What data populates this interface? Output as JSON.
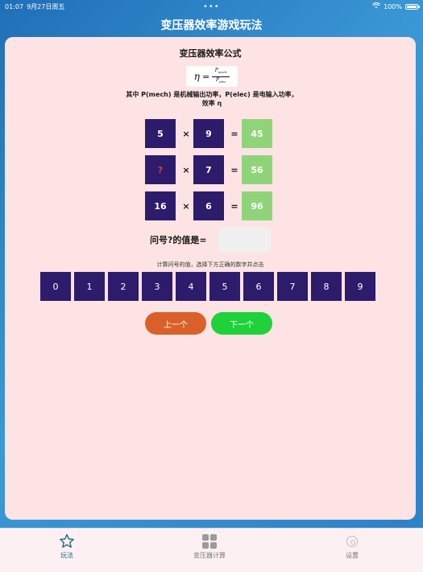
{
  "status_bar": {
    "time": "01:07",
    "date": "9月27日周五",
    "dots": "•••",
    "battery": "100%",
    "battery_level": 1.0
  },
  "header": {
    "title": "变压器效率游戏玩法"
  },
  "card": {
    "title": "变压器效率公式",
    "formula": {
      "eta": "η",
      "equals": "=",
      "numerator": "P",
      "numerator_sub": "mech",
      "denominator": "P",
      "denominator_sub": "elec"
    },
    "description": "其中 P(mech) 是机械输出功率，P(elec) 是电输入功率，效率 η",
    "puzzles": [
      {
        "a": "5",
        "op": "×",
        "b": "9",
        "eq": "=",
        "result": "45"
      },
      {
        "a": "?",
        "op": "×",
        "b": "7",
        "eq": "=",
        "result": "56"
      },
      {
        "a": "16",
        "op": "×",
        "b": "6",
        "eq": "=",
        "result": "96"
      }
    ],
    "answer_label": "问号?的值是=",
    "instruction": "计算问号的值，选择下方正确的数字并点击",
    "digits": [
      "0",
      "1",
      "2",
      "3",
      "4",
      "5",
      "6",
      "7",
      "8",
      "9"
    ],
    "prev_label": "上一个",
    "next_label": "下一个"
  },
  "tabbar": {
    "items": [
      {
        "label": "玩法",
        "icon": "star-icon",
        "active": true
      },
      {
        "label": "变压器计算",
        "icon": "grid-icon",
        "active": false
      },
      {
        "label": "设置",
        "icon": "gear-icon",
        "active": false
      }
    ]
  },
  "colors": {
    "tile_dark": "#2d1b6b",
    "tile_green": "#90d47a",
    "unknown_text": "#e53a3a",
    "prev_button": "#d9602a",
    "next_button": "#1fd13a",
    "card_bg": "#fde3e3"
  }
}
